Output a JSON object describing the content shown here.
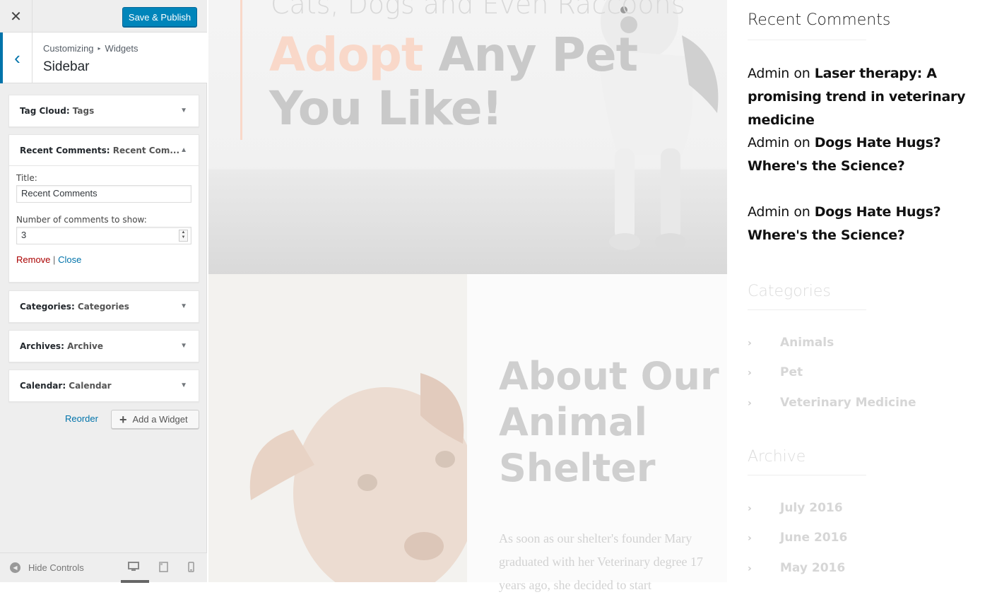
{
  "header": {
    "close_glyph": "✕",
    "save_label": "Save & Publish"
  },
  "section": {
    "back_glyph": "‹",
    "breadcrumb_root": "Customizing",
    "breadcrumb_sep": "▸",
    "breadcrumb_current": "Widgets",
    "title": "Sidebar"
  },
  "widgets": [
    {
      "type": "Tag Cloud",
      "title": "Tags"
    },
    {
      "type": "Recent Comments",
      "title": "Recent Com..."
    },
    {
      "type": "Categories",
      "title": "Categories"
    },
    {
      "type": "Archives",
      "title": "Archive"
    },
    {
      "type": "Calendar",
      "title": "Calendar"
    }
  ],
  "recent_form": {
    "title_label": "Title:",
    "title_value": "Recent Comments",
    "number_label": "Number of comments to show:",
    "number_value": "3",
    "remove_label": "Remove",
    "separator": "|",
    "close_label": "Close"
  },
  "actions": {
    "reorder_label": "Reorder",
    "add_widget_label": "Add a Widget"
  },
  "footer": {
    "hide_controls_label": "Hide Controls"
  },
  "preview": {
    "hero_subtitle": "Cats, Dogs and Even Raccoons",
    "hero_title_accent": "Adopt",
    "hero_title_rest": " Any Pet You Like!",
    "about_title": "About Our Animal Shelter",
    "about_text": "As soon as our shelter's founder Mary graduated with her Veterinary degree 17 years ago, she decided to start",
    "sidebar": {
      "recent_heading": "Recent Comments",
      "comments": [
        {
          "author": "Admin",
          "on": "on",
          "post": "Laser therapy: A promising trend in veterinary medicine"
        },
        {
          "author": "Admin",
          "on": "on",
          "post": "Dogs Hate Hugs? Where's the Science?"
        },
        {
          "author": "Admin",
          "on": "on",
          "post": "Dogs Hate Hugs? Where's the Science?"
        }
      ],
      "categories_heading": "Categories",
      "categories": [
        "Animals",
        "Pet",
        "Veterinary Medicine"
      ],
      "archive_heading": "Archive",
      "archives": [
        "July 2016",
        "June 2016",
        "May 2016"
      ]
    }
  },
  "colors": {
    "primary_button": "#0085ba",
    "link": "#0073aa",
    "remove": "#aa0000",
    "accent": "#f9d8c9"
  }
}
